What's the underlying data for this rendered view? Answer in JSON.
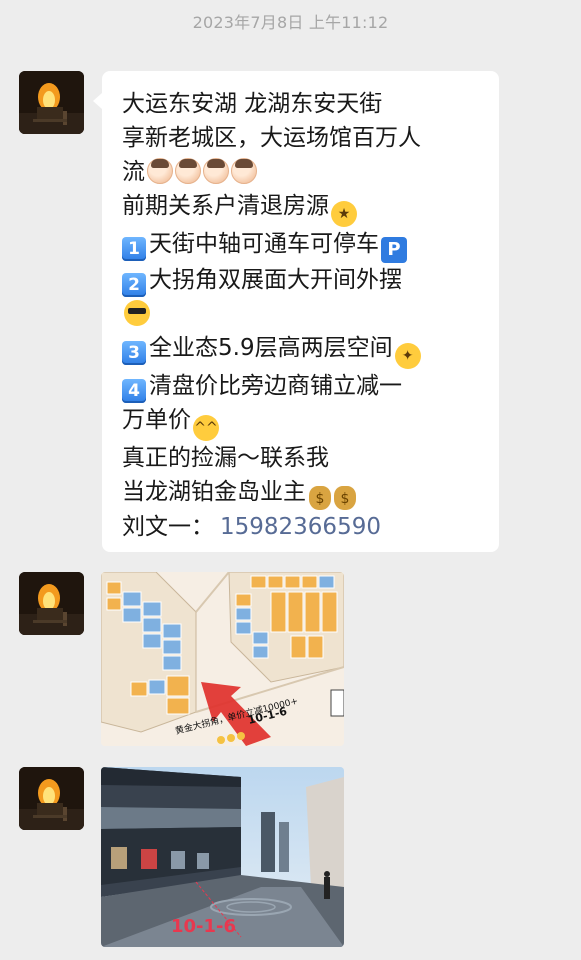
{
  "chat": {
    "timestamp": "2023年7月8日 上午11:12",
    "text_message": {
      "line1": "大运东安湖 龙湖东安天街",
      "line2": "享新老城区，大运场馆百万人",
      "line3": "流",
      "line4": "前期关系户清退房源",
      "item1_num": "1",
      "item1_text": "天街中轴可通车可停车",
      "item1_badge": "P",
      "item2_num": "2",
      "item2_text": "大拐角双展面大开间外摆",
      "item3_num": "3",
      "item3_text": "全业态5.9层高两层空间",
      "item4_num": "4",
      "item4_text": "清盘价比旁边商铺立减一",
      "line_cont": "万单价",
      "line_bargain": "真正的捡漏～联系我",
      "line_owner": "当龙湖铂金岛业主",
      "contact_name": "刘文一：",
      "contact_phone": "15982366590"
    },
    "image1": {
      "caption_main": "黄金大拐角，单价立减10000+",
      "unit_label": "10-1-6"
    },
    "image2": {
      "unit_label": "10-1-6"
    },
    "colors": {
      "background": "#ededed",
      "bubble": "#ffffff",
      "phone_link": "#576b95",
      "timestamp": "#a6a6a6"
    }
  }
}
